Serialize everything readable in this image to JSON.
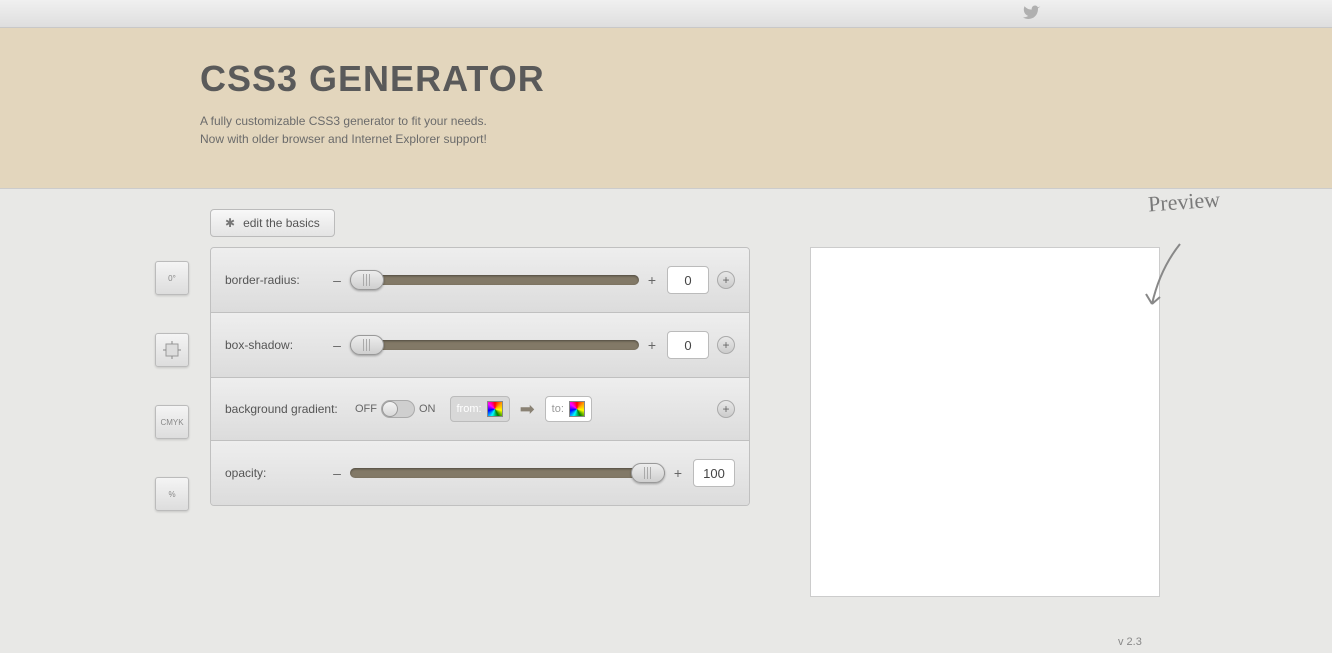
{
  "header": {
    "title": "CSS3 GENERATOR",
    "tagline1": "A fully customizable CSS3 generator to fit your needs.",
    "tagline2": "Now with older browser and Internet Explorer support!"
  },
  "editBasics": "edit the basics",
  "panels": {
    "borderRadius": {
      "label": "border-radius:",
      "value": "0",
      "handlePos": 0
    },
    "boxShadow": {
      "label": "box-shadow:",
      "value": "0",
      "handlePos": 0
    },
    "gradient": {
      "label": "background gradient:",
      "off": "OFF",
      "on": "ON",
      "from": "from:",
      "to": "to:"
    },
    "opacity": {
      "label": "opacity:",
      "value": "100",
      "handlePos": 88
    }
  },
  "leftIcons": {
    "i1": "0°",
    "i3": "CMYK",
    "i4": "%"
  },
  "preview": "Preview",
  "version": "v 2.3",
  "symbols": {
    "minus": "–",
    "plus": "+",
    "add": "+"
  }
}
